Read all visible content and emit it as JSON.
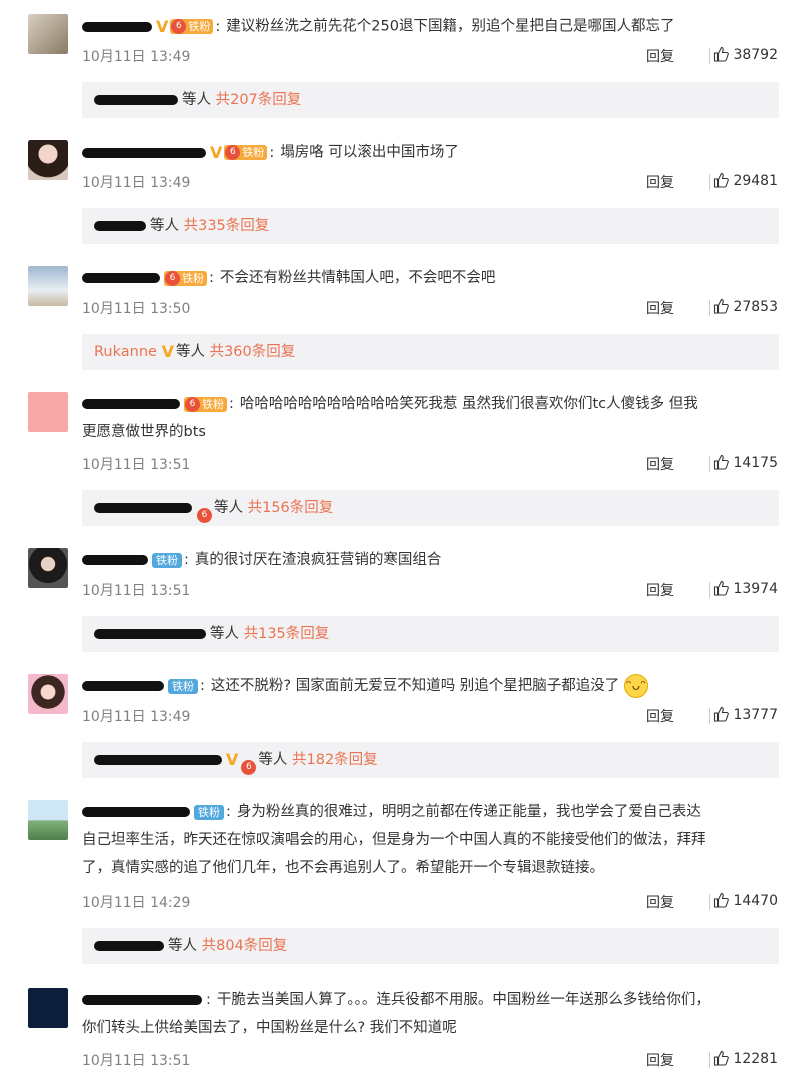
{
  "labels": {
    "reply": "回复",
    "fan": "铁粉",
    "level": "6",
    "others": "等人"
  },
  "comments": [
    {
      "text": "建议粉丝洗之前先花个250退下国籍，别追个星把自己是哪国人都忘了",
      "time": "10月11日 13:49",
      "likes": "38792",
      "sub_count": "共207条回复"
    },
    {
      "text": "塌房咯  可以滚出中国市场了",
      "time": "10月11日 13:49",
      "likes": "29481",
      "sub_count": "共335条回复"
    },
    {
      "text": "不会还有粉丝共情韩国人吧，不会吧不会吧",
      "time": "10月11日 13:50",
      "likes": "27853",
      "sub_name": "Rukanne",
      "sub_count": "共360条回复"
    },
    {
      "text": "哈哈哈哈哈哈哈哈哈哈哈笑死我惹 虽然我们很喜欢你们tc人傻钱多 但我",
      "text2": "更愿意做世界的bts",
      "time": "10月11日 13:51",
      "likes": "14175",
      "sub_count": "共156条回复"
    },
    {
      "text": "真的很讨厌在渣浪疯狂营销的寒国组合",
      "time": "10月11日 13:51",
      "likes": "13974",
      "sub_count": "共135条回复"
    },
    {
      "text": "这还不脱粉? 国家面前无爱豆不知道吗 别追个星把脑子都追没了",
      "time": "10月11日 13:49",
      "likes": "13777",
      "sub_count": "共182条回复"
    },
    {
      "text": "身为粉丝真的很难过，明明之前都在传递正能量，我也学会了爱自己表达",
      "text2": "自己坦率生活，昨天还在惊叹演唱会的用心，但是身为一个中国人真的不能接受他们的做法，拜拜",
      "text3": "了，真情实感的追了他们几年，也不会再追别人了。希望能开一个专辑退款链接。",
      "time": "10月11日 14:29",
      "likes": "14470",
      "sub_count": "共804条回复"
    },
    {
      "text": "干脆去当美国人算了。。。连兵役都不用服。中国粉丝一年送那么多钱给你们，",
      "text2": "你们转头上供给美国去了，中国粉丝是什么? 我们不知道呢",
      "time": "10月11日 13:51",
      "likes": "12281"
    }
  ],
  "colors": {
    "accent": "#eb7350",
    "fan_badge": "#f7a93b",
    "fan_badge_plain": "#52a8dc",
    "sub_bg": "#f2f2f5",
    "meta": "#808080"
  },
  "icons": {
    "like": "thumbs-up-icon",
    "verified": "verified-v-icon",
    "emoji": "grinning-face-icon"
  }
}
